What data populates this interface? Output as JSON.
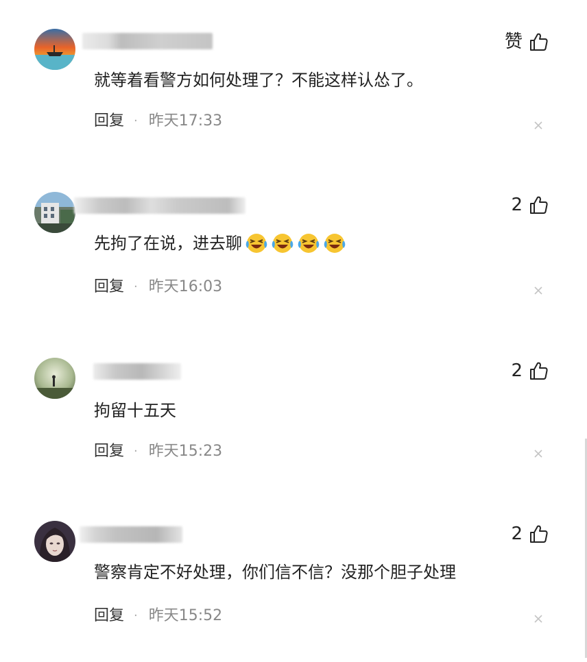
{
  "comments": [
    {
      "like_label": "赞",
      "text": "就等着看警方如何处理了？不能这样认怂了。",
      "reply_label": "回复",
      "separator": "·",
      "time": "昨天17:33",
      "avatar_icon": "avatar-boat-sunset"
    },
    {
      "like_label": "2",
      "text": "先拘了在说，进去聊",
      "emojis": [
        "laughing-crying-emoji",
        "laughing-crying-emoji",
        "laughing-crying-emoji",
        "laughing-crying-emoji"
      ],
      "reply_label": "回复",
      "separator": "·",
      "time": "昨天16:03",
      "avatar_icon": "avatar-building"
    },
    {
      "like_label": "2",
      "text": "拘留十五天",
      "reply_label": "回复",
      "separator": "·",
      "time": "昨天15:23",
      "avatar_icon": "avatar-person-field"
    },
    {
      "like_label": "2",
      "text": "警察肯定不好处理，你们信不信？没那个胆子处理",
      "reply_label": "回复",
      "separator": "·",
      "time": "昨天15:52",
      "avatar_icon": "avatar-anime-girl"
    }
  ],
  "colors": {
    "text": "#222222",
    "time": "#888888",
    "blur_name": "#c8c8c8"
  }
}
